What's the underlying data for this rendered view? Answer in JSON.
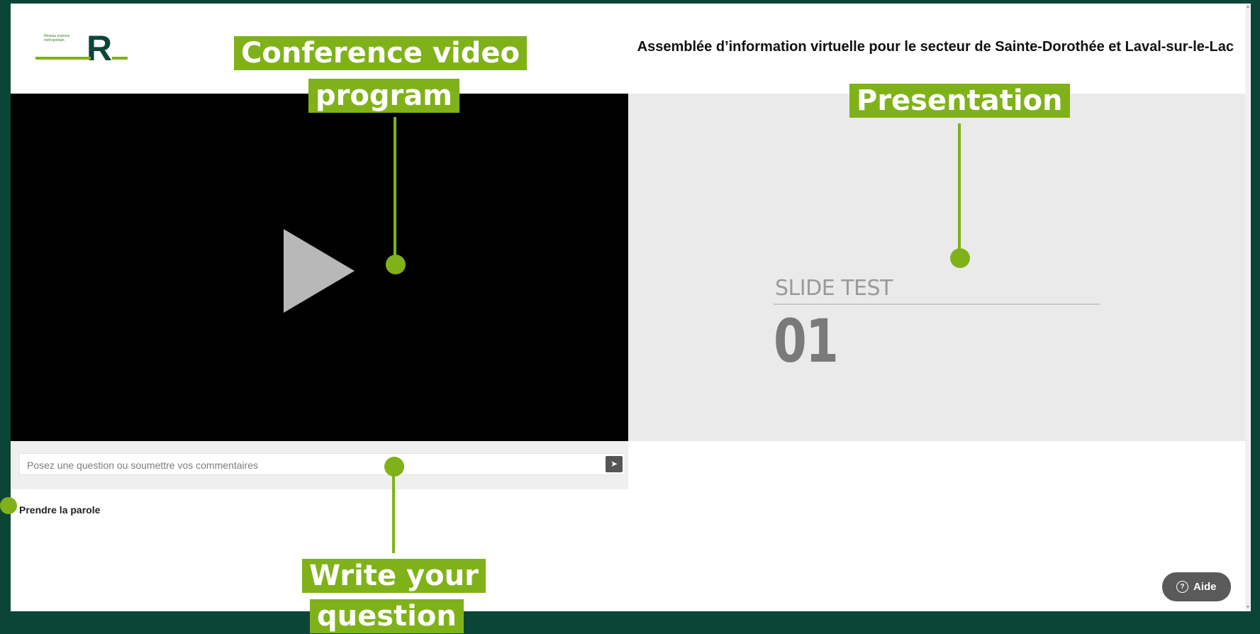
{
  "header": {
    "logo_text": "Réseau express métropolitain",
    "logo_letter": "R",
    "page_title": "Assemblée d’information virtuelle pour le secteur de Sainte-Dorothée et Laval-sur-le-Lac"
  },
  "video": {
    "play_icon": "play-icon"
  },
  "slide": {
    "caption": "SLIDE TEST",
    "number": "01"
  },
  "question": {
    "placeholder": "Posez une question ou soumettre vos commentaires",
    "send_icon": "send-icon"
  },
  "speak_link": "Prendre la parole",
  "help": {
    "icon": "?",
    "label": "Aide"
  },
  "annotations": {
    "video_label_line1": "Conference video",
    "video_label_line2": "program",
    "presentation_label": "Presentation",
    "question_label_line1": "Write your",
    "question_label_line2": "question"
  },
  "colors": {
    "background": "#0b4538",
    "annotation": "#7fb219",
    "logo_dark": "#0c4639"
  }
}
